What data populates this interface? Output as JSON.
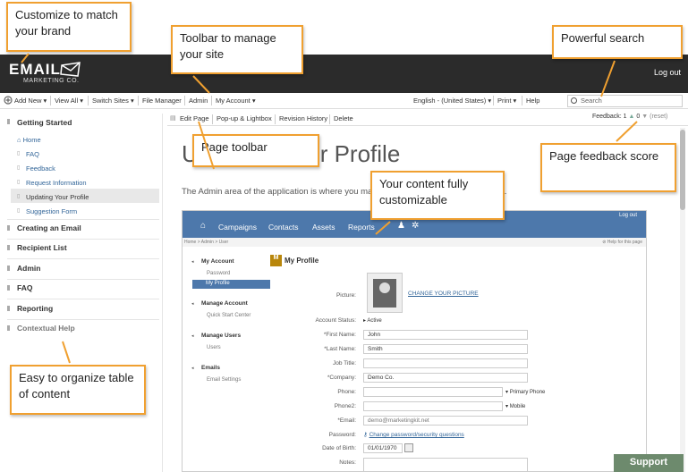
{
  "brand": {
    "logo_main": "EMAIL",
    "logo_sub": "MARKETING CO.",
    "logout": "Log out"
  },
  "toolbar": {
    "items": [
      "Add New",
      "View All",
      "Switch Sites",
      "File Manager",
      "Admin",
      "My Account"
    ],
    "language": "English - (United States)",
    "print": "Print",
    "help": "Help",
    "search_placeholder": "Search"
  },
  "sidebar": {
    "getting_started": "Getting Started",
    "items": [
      "Home",
      "FAQ",
      "Feedback",
      "Request Information",
      "Updating Your Profile",
      "Suggestion Form"
    ],
    "sections": [
      "Creating an Email",
      "Recipient List",
      "Admin",
      "FAQ",
      "Reporting",
      "Contextual Help"
    ]
  },
  "page_toolbar": {
    "items": [
      "Edit Page",
      "Pop-up & Lightbox",
      "Revision History",
      "Delete"
    ],
    "feedback_label": "Feedback:",
    "feedback_up": "1",
    "feedback_down": "0",
    "reset": "(reset)"
  },
  "page": {
    "title": "Updating Your Profile",
    "desc": "The Admin area of the application is where you manage your account and set settings."
  },
  "screenshot": {
    "nav": [
      "Campaigns",
      "Contacts",
      "Assets",
      "Reports"
    ],
    "logout": "Log out",
    "breadcrumb": "Home > Admin > User",
    "help_link": "Help for this page",
    "side": {
      "my_account": "My Account",
      "password": "Password",
      "my_profile": "My Profile",
      "manage_account": "Manage Account",
      "quick_start": "Quick Start Center",
      "manage_users": "Manage Users",
      "users": "Users",
      "emails": "Emails",
      "email_settings": "Email Settings"
    },
    "form_title": "My Profile",
    "change_picture": "CHANGE YOUR PICTURE",
    "labels": {
      "picture": "Picture:",
      "status": "Account Status:",
      "first": "*First Name:",
      "last": "*Last Name:",
      "job": "Job Title:",
      "company": "*Company:",
      "phone": "Phone:",
      "phone2": "Phone2:",
      "email": "*Email:",
      "password": "Password:",
      "dob": "Date of Birth:",
      "notes": "Notes:"
    },
    "values": {
      "status": "Active",
      "first": "John",
      "last": "Smith",
      "job": "",
      "company": "Demo Co.",
      "primary_phone": "Primary Phone",
      "mobile": "Mobile",
      "email": "demo@marketingkit.net",
      "password_link": "Change password/security questions",
      "dob": "01/01/1970"
    }
  },
  "callouts": {
    "brand": "Customize to match your brand",
    "toolbar": "Toolbar to manage your site",
    "search": "Powerful search",
    "page_toolbar": "Page toolbar",
    "content": "Your content fully customizable",
    "feedback": "Page feedback score",
    "toc": "Easy to organize table of content"
  },
  "support": "Support",
  "colors": {
    "header_bg": "#2b2b2b",
    "accent": "#f0a030",
    "nav_blue": "#4d78ab",
    "link": "#336699",
    "support_bg": "#6d8a6d"
  }
}
